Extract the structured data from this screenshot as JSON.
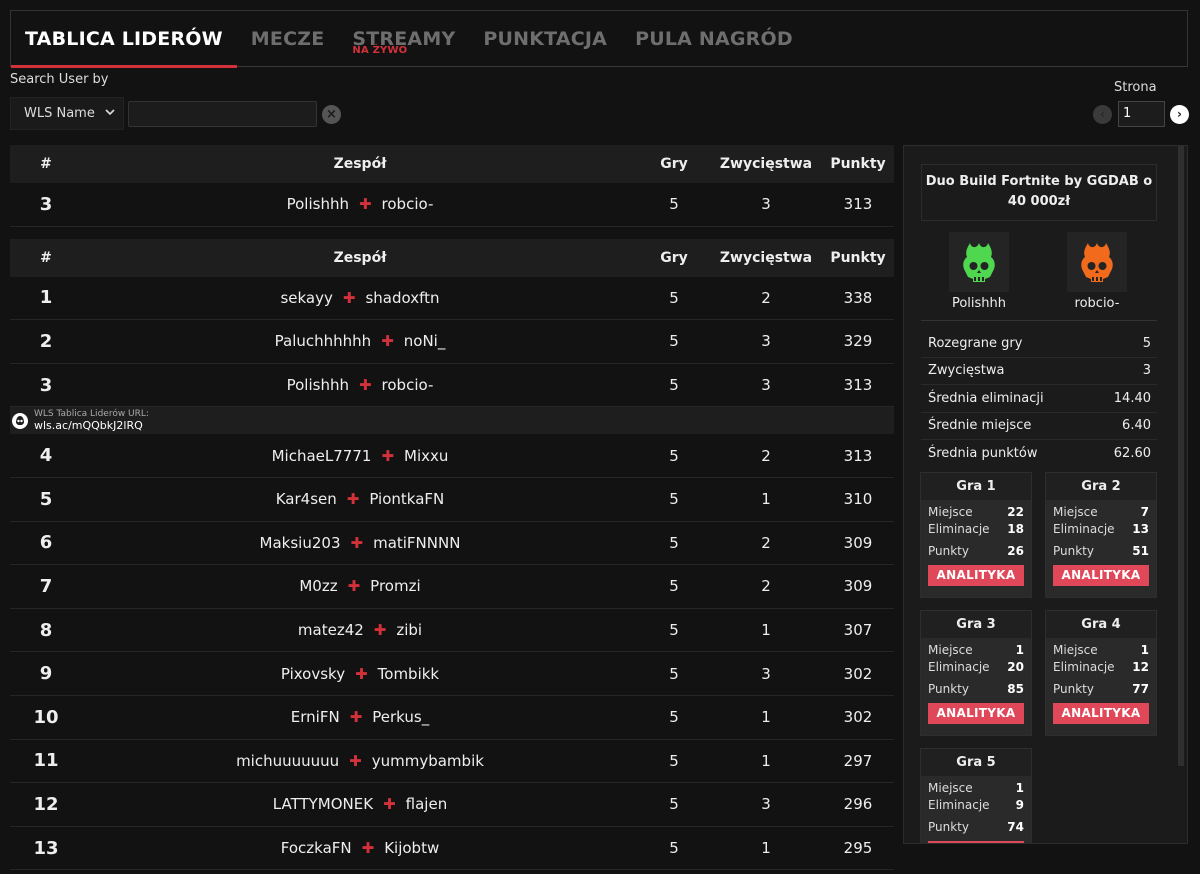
{
  "tabs": [
    {
      "label": "TABLICA LIDERÓW",
      "active": true
    },
    {
      "label": "MECZE"
    },
    {
      "label": "STREAMY",
      "sub": "NA ŻYWO"
    },
    {
      "label": "PUNKTACJA"
    },
    {
      "label": "PULA NAGRÓD"
    }
  ],
  "search": {
    "label": "Search User by",
    "select_value": "WLS Name",
    "placeholder": ""
  },
  "pagination": {
    "label": "Strona",
    "page": "1"
  },
  "table": {
    "headers": {
      "rank": "#",
      "team": "Zespół",
      "games": "Gry",
      "wins": "Zwycięstwa",
      "points": "Punkty"
    },
    "highlight": {
      "rank": "3",
      "p1": "Polishhh",
      "p2": "robcio-",
      "games": "5",
      "wins": "3",
      "points": "313"
    },
    "url_bar": {
      "label": "WLS Tablica Liderów URL:",
      "link": "wls.ac/mQQbkJ2lRQ"
    },
    "rows_top": [
      {
        "rank": "1",
        "p1": "sekayy",
        "p2": "shadoxftn",
        "games": "5",
        "wins": "2",
        "points": "338"
      },
      {
        "rank": "2",
        "p1": "Paluchhhhhh",
        "p2": "noNi_",
        "games": "5",
        "wins": "3",
        "points": "329"
      },
      {
        "rank": "3",
        "p1": "Polishhh",
        "p2": "robcio-",
        "games": "5",
        "wins": "3",
        "points": "313"
      }
    ],
    "rows_bottom": [
      {
        "rank": "4",
        "p1": "MichaeL7771",
        "p2": "Mixxu",
        "games": "5",
        "wins": "2",
        "points": "313"
      },
      {
        "rank": "5",
        "p1": "Kar4sen",
        "p2": "PiontkaFN",
        "games": "5",
        "wins": "1",
        "points": "310"
      },
      {
        "rank": "6",
        "p1": "Maksiu203",
        "p2": "matiFNNNN",
        "games": "5",
        "wins": "2",
        "points": "309"
      },
      {
        "rank": "7",
        "p1": "M0zz",
        "p2": "Promzi",
        "games": "5",
        "wins": "2",
        "points": "309"
      },
      {
        "rank": "8",
        "p1": "matez42",
        "p2": "zibi",
        "games": "5",
        "wins": "1",
        "points": "307"
      },
      {
        "rank": "9",
        "p1": "Pixovsky",
        "p2": "Tombikk",
        "games": "5",
        "wins": "3",
        "points": "302"
      },
      {
        "rank": "10",
        "p1": "ErniFN",
        "p2": "Perkus_",
        "games": "5",
        "wins": "1",
        "points": "302"
      },
      {
        "rank": "11",
        "p1": "michuuuuuuu",
        "p2": "yummybambik",
        "games": "5",
        "wins": "1",
        "points": "297"
      },
      {
        "rank": "12",
        "p1": "LATTYMONEK",
        "p2": "flajen",
        "games": "5",
        "wins": "3",
        "points": "296"
      },
      {
        "rank": "13",
        "p1": "FoczkaFN",
        "p2": "Kijobtw",
        "games": "5",
        "wins": "1",
        "points": "295"
      }
    ]
  },
  "panel": {
    "title": "Duo Build Fortnite by GGDAB o 40 000zł",
    "player1": {
      "name": "Polishhh",
      "avatar_color": "#4fd84f"
    },
    "player2": {
      "name": "robcio-",
      "avatar_color": "#f26a1b"
    },
    "stats": [
      {
        "label": "Rozegrane gry",
        "value": "5"
      },
      {
        "label": "Zwycięstwa",
        "value": "3"
      },
      {
        "label": "Średnia eliminacji",
        "value": "14.40"
      },
      {
        "label": "Średnie miejsce",
        "value": "6.40"
      },
      {
        "label": "Średnia punktów",
        "value": "62.60"
      }
    ],
    "labels": {
      "place": "Miejsce",
      "elims": "Eliminacje",
      "points": "Punkty",
      "button": "ANALITYKA"
    },
    "games": [
      {
        "title": "Gra 1",
        "place": "22",
        "elims": "18",
        "points": "26"
      },
      {
        "title": "Gra 2",
        "place": "7",
        "elims": "13",
        "points": "51"
      },
      {
        "title": "Gra 3",
        "place": "1",
        "elims": "20",
        "points": "85"
      },
      {
        "title": "Gra 4",
        "place": "1",
        "elims": "12",
        "points": "77"
      },
      {
        "title": "Gra 5",
        "place": "1",
        "elims": "9",
        "points": "74"
      }
    ]
  },
  "colors": {
    "accent": "#d3313a",
    "button": "#e0485a",
    "background": "#121212"
  }
}
